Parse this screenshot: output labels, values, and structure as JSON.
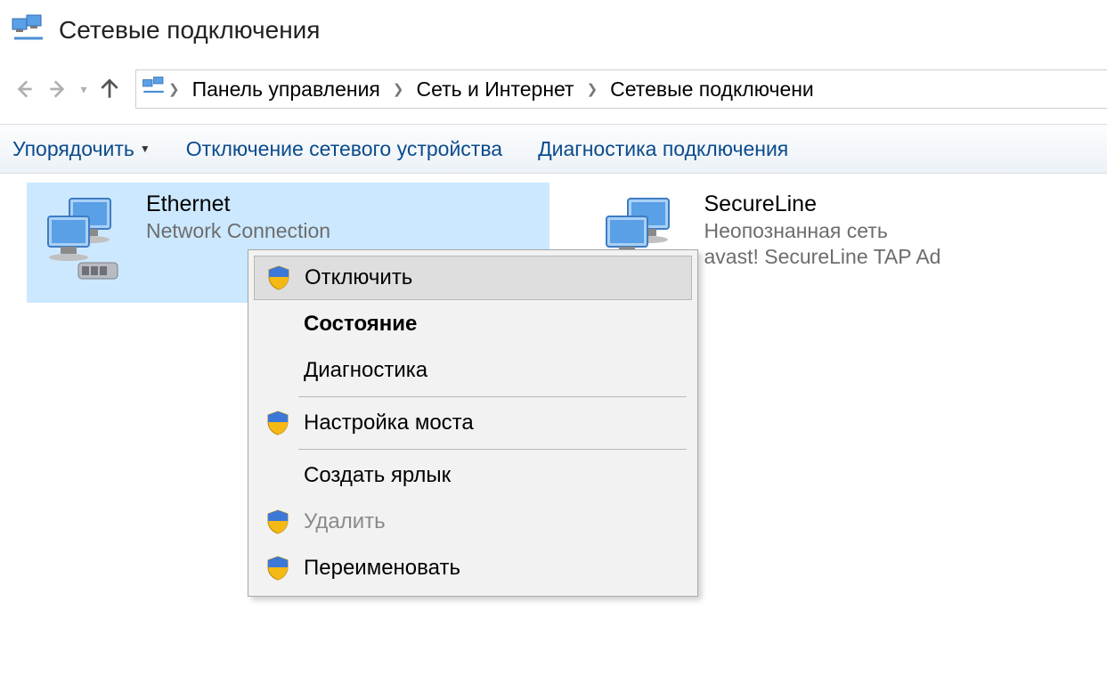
{
  "window": {
    "title": "Сетевые подключения"
  },
  "breadcrumb": {
    "items": [
      {
        "label": "Панель управления"
      },
      {
        "label": "Сеть и Интернет"
      },
      {
        "label": "Сетевые подключени"
      }
    ]
  },
  "toolbar": {
    "organize": "Упорядочить",
    "disable_device": "Отключение сетевого устройства",
    "diagnose": "Диагностика подключения"
  },
  "connections": [
    {
      "name": "Ethernet",
      "line2": "Network Connection",
      "line3": "",
      "selected": true
    },
    {
      "name": "SecureLine",
      "line2": "Неопознанная сеть",
      "line3": "avast! SecureLine TAP Ad",
      "selected": false
    }
  ],
  "context_menu": {
    "disable": "Отключить",
    "status": "Состояние",
    "diagnose": "Диагностика",
    "bridge": "Настройка моста",
    "shortcut": "Создать ярлык",
    "delete": "Удалить",
    "rename": "Переименовать"
  }
}
